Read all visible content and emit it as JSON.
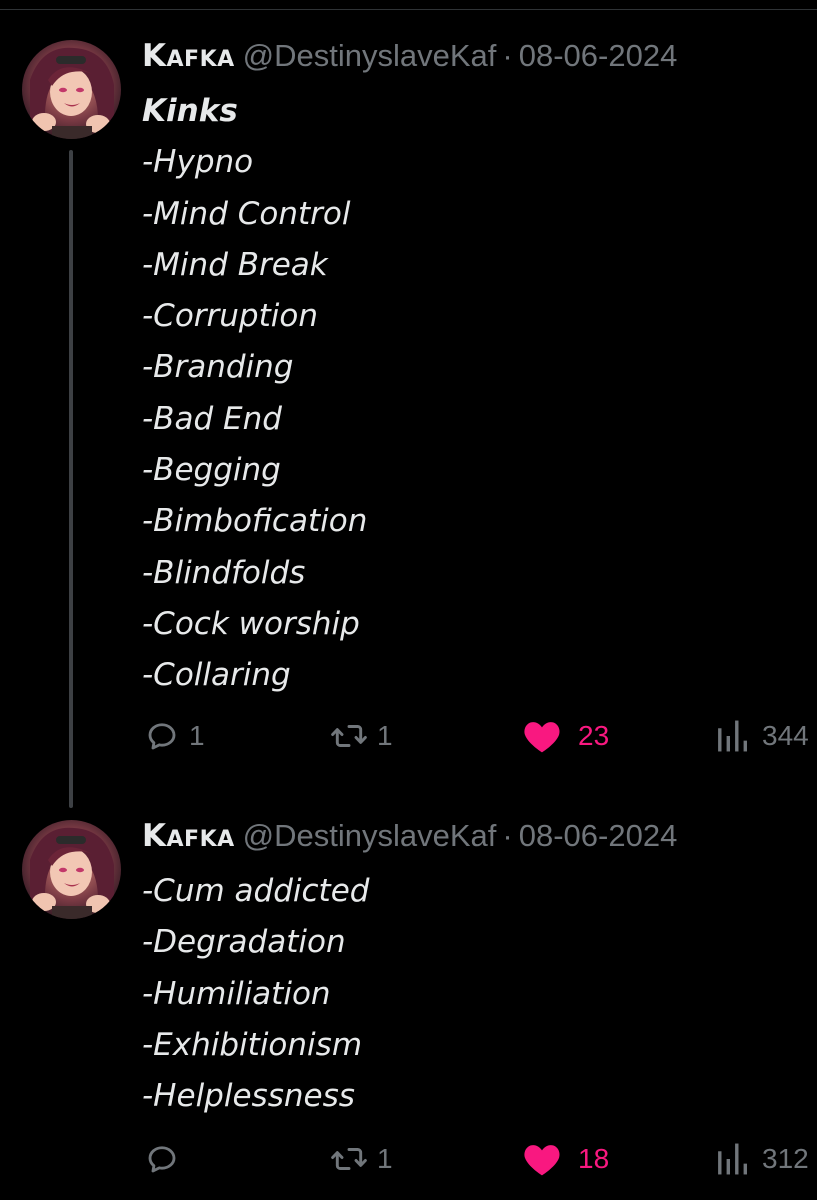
{
  "colors": {
    "background": "#000000",
    "text_primary": "#e7e9ea",
    "text_secondary": "#71767b",
    "like_active": "#f91880",
    "thread_line": "#3d4044"
  },
  "tweets": [
    {
      "display_name": "Kafka",
      "handle": "@DestinyslaveKaf",
      "separator": "·",
      "date": "08-06-2024",
      "title": "Kinks",
      "lines": [
        "-Hypno",
        "-Mind Control",
        "-Mind Break",
        "-Corruption",
        "-Branding",
        "-Bad End",
        "-Begging",
        "-Bimbofication",
        "-Blindfolds",
        "-Cock worship",
        "-Collaring"
      ],
      "actions": {
        "reply_icon": "reply-bubble-icon",
        "reply_count": "1",
        "retweet_icon": "retweet-icon",
        "retweet_count": "1",
        "like_icon": "heart-filled-icon",
        "like_count": "23",
        "views_icon": "views-bar-icon",
        "views_count": "344"
      }
    },
    {
      "display_name": "Kafka",
      "handle": "@DestinyslaveKaf",
      "separator": "·",
      "date": "08-06-2024",
      "lines": [
        "-Cum addicted",
        "-Degradation",
        "-Humiliation",
        "-Exhibitionism",
        "-Helplessness"
      ],
      "actions": {
        "reply_icon": "reply-bubble-icon",
        "reply_count": "",
        "retweet_icon": "retweet-icon",
        "retweet_count": "1",
        "like_icon": "heart-filled-icon",
        "like_count": "18",
        "views_icon": "views-bar-icon",
        "views_count": "312"
      }
    }
  ]
}
